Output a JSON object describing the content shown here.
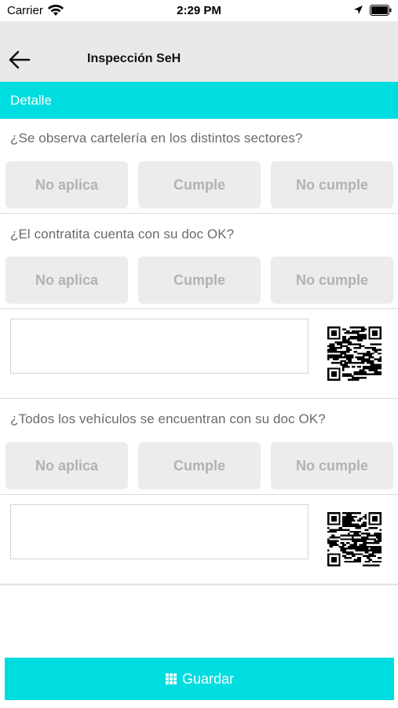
{
  "status_bar": {
    "carrier": "Carrier",
    "time": "2:29 PM"
  },
  "nav": {
    "title": "Inspección SeH"
  },
  "section": {
    "title": "Detalle"
  },
  "questions": [
    {
      "text": "¿Se observa cartelería en los distintos sectores?",
      "options": [
        "No aplica",
        "Cumple",
        "No cumple"
      ]
    },
    {
      "text": "¿El contratita cuenta con su doc OK?",
      "options": [
        "No aplica",
        "Cumple",
        "No cumple"
      ]
    },
    {
      "text": "¿Todos los vehículos se encuentran con su doc OK?",
      "options": [
        "No aplica",
        "Cumple",
        "No cumple"
      ]
    }
  ],
  "save": {
    "label": "Guardar"
  },
  "colors": {
    "accent": "#00dde0",
    "nav_bg": "#e9e9e9",
    "button_bg": "#ececec",
    "button_text": "#b2b2b2"
  }
}
